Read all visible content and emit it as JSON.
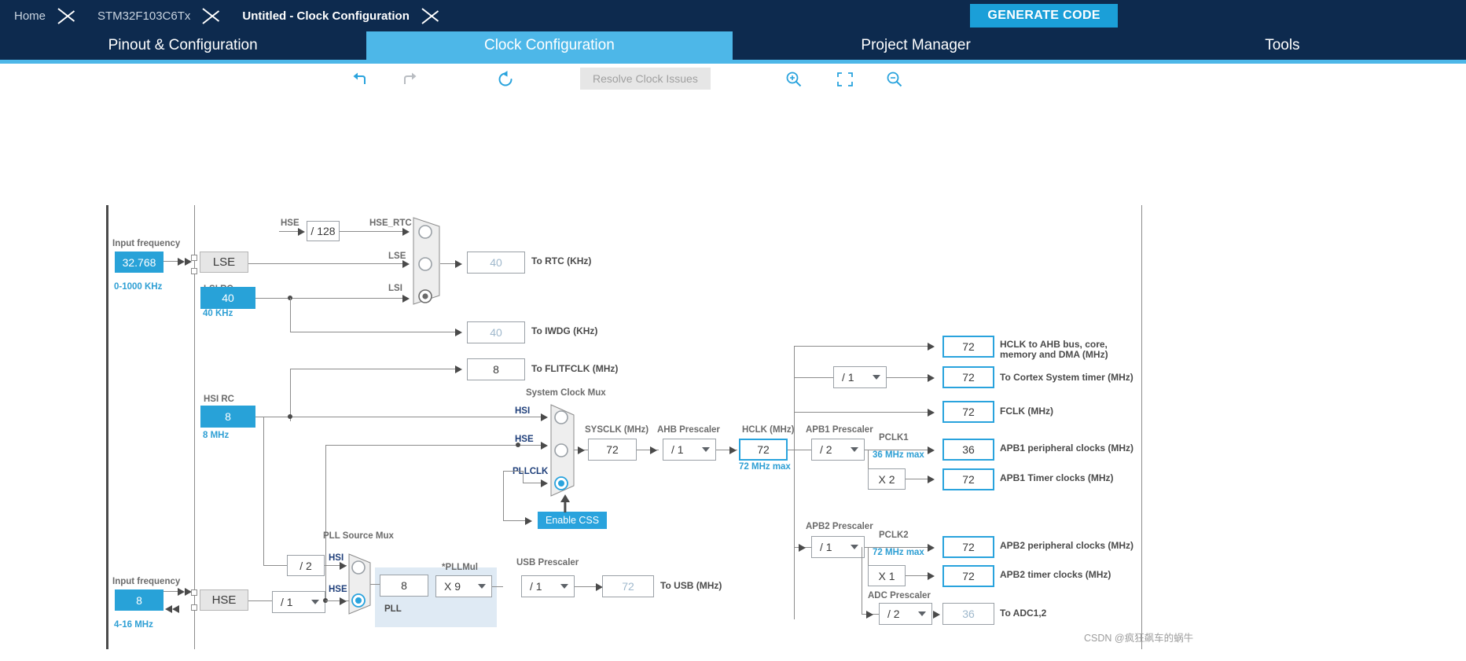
{
  "breadcrumb": {
    "items": [
      {
        "label": "Home",
        "active": false
      },
      {
        "label": "STM32F103C6Tx",
        "active": false
      },
      {
        "label": "Untitled - Clock Configuration",
        "active": true
      }
    ],
    "generate_code_label": "GENERATE CODE"
  },
  "tabs": [
    {
      "label": "Pinout & Configuration",
      "active": false
    },
    {
      "label": "Clock Configuration",
      "active": true
    },
    {
      "label": "Project Manager",
      "active": false
    },
    {
      "label": "Tools",
      "active": false
    }
  ],
  "toolbar": {
    "undo_icon": "undo-icon",
    "redo_icon": "redo-icon",
    "reset_icon": "reset-icon",
    "resolve_label": "Resolve Clock Issues",
    "zoom_in_icon": "zoom-in-icon",
    "fit_icon": "fit-to-screen-icon",
    "zoom_out_icon": "zoom-out-icon"
  },
  "diagram": {
    "lse": {
      "input_frequency_label": "Input frequency",
      "input_value": "32.768",
      "range_label": "0-1000 KHz",
      "osc_label": "LSE"
    },
    "lsi": {
      "title": "LSI RC",
      "value": "40",
      "range_label": "40 KHz"
    },
    "hsi": {
      "title": "HSI RC",
      "value": "8",
      "range_label": "8 MHz"
    },
    "hse": {
      "input_frequency_label": "Input frequency",
      "input_value": "8",
      "range_label": "4-16 MHz",
      "osc_label": "HSE",
      "prescaler": "/ 1"
    },
    "hse_rtc_divider": "/ 128",
    "rtc_mux": {
      "inputs": [
        {
          "label": "HSE",
          "selected": false
        },
        {
          "label": "HSE_RTC",
          "is_signal_name": true
        },
        {
          "label": "LSE",
          "selected": false
        },
        {
          "label": "LSI",
          "selected": true
        }
      ]
    },
    "outputs_left": [
      {
        "value": "40",
        "label": "To RTC (KHz)",
        "dim": true
      },
      {
        "value": "40",
        "label": "To IWDG (KHz)",
        "dim": true
      },
      {
        "value": "8",
        "label": "To FLITFCLK (MHz)",
        "dim": false
      }
    ],
    "system_clock_mux": {
      "title": "System Clock Mux",
      "inputs": [
        {
          "label": "HSI",
          "selected": false
        },
        {
          "label": "HSE",
          "selected": false
        },
        {
          "label": "PLLCLK",
          "selected": true
        }
      ]
    },
    "enable_css_label": "Enable CSS",
    "sysclk": {
      "label": "SYSCLK (MHz)",
      "value": "72"
    },
    "ahb_prescaler": {
      "label": "AHB Prescaler",
      "value": "/ 1"
    },
    "hclk": {
      "label": "HCLK (MHz)",
      "value": "72",
      "max_note": "72 MHz max"
    },
    "pll_source_mux": {
      "title": "PLL Source Mux",
      "inputs": [
        {
          "label": "HSI",
          "selected": false
        },
        {
          "label": "HSE",
          "selected": true
        }
      ],
      "hsi_divider": "/ 2"
    },
    "pll": {
      "group_label": "PLL",
      "pllmul_label": "*PLLMul",
      "input_value": "8",
      "mul_value": "X 9"
    },
    "usb": {
      "prescaler_label": "USB Prescaler",
      "prescaler_value": "/ 1",
      "value": "72",
      "label": "To USB (MHz)"
    },
    "cortex_prescaler": "/ 1",
    "apb1": {
      "prescaler_label": "APB1 Prescaler",
      "prescaler_value": "/ 2",
      "pclk_label": "PCLK1",
      "max_note": "36 MHz max",
      "timer_multiplier": "X 2",
      "peripheral_value": "36",
      "peripheral_label": "APB1 peripheral clocks (MHz)",
      "timer_value": "72",
      "timer_label": "APB1 Timer clocks (MHz)"
    },
    "apb2": {
      "prescaler_label": "APB2 Prescaler",
      "prescaler_value": "/ 1",
      "pclk_label": "PCLK2",
      "max_note": "72 MHz max",
      "timer_multiplier": "X 1",
      "peripheral_value": "72",
      "peripheral_label": "APB2 peripheral clocks (MHz)",
      "timer_value": "72",
      "timer_label": "APB2 timer clocks (MHz)"
    },
    "adc": {
      "prescaler_label": "ADC Prescaler",
      "prescaler_value": "/ 2",
      "value": "36",
      "label": "To ADC1,2"
    },
    "ahb_outputs": [
      {
        "value": "72",
        "label": "HCLK to AHB bus, core,\nmemory and DMA (MHz)"
      },
      {
        "value": "72",
        "label": "To Cortex System timer (MHz)"
      },
      {
        "value": "72",
        "label": "FCLK (MHz)"
      }
    ]
  },
  "watermark": "CSDN @疯狂飙车的蜗牛"
}
